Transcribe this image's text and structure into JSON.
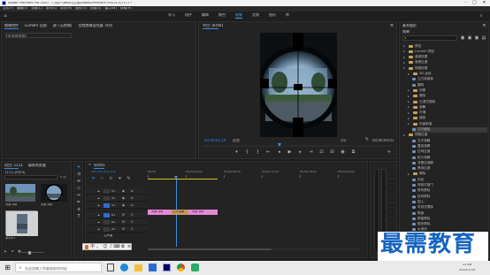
{
  "title_bar": {
    "title": "Adobe Premiere Pro 2020 - C:\\用户\\Baiyu\\文档\\Adobe\\Premiere Pro\\14.0\\1111 *"
  },
  "menu": [
    "文件(F)",
    "编辑(E)",
    "剪辑(C)",
    "序列(S)",
    "标记(M)",
    "图形(G)",
    "视图(V)",
    "窗口(W)",
    "帮助(H)"
  ],
  "workspace_tabs": [
    "学习",
    "组件",
    "编辑",
    "颜色",
    "效果",
    "音频",
    "图形",
    "库"
  ],
  "active_workspace": "效果",
  "source_panel": {
    "tabs": [
      "效果控件",
      "Lumetri 范围",
      "源: (无剪辑)",
      "音频剪辑混合器: 序列"
    ],
    "info": "(未选择剪辑)"
  },
  "program_monitor": {
    "title": "节目: 序列01",
    "timecode": "00;00;01;14",
    "fit_label": "适合",
    "quality": "1/2",
    "duration": "00;00;04;01"
  },
  "project_panel": {
    "tabs": [
      "项目: 1111",
      "媒体浏览器"
    ],
    "path": "1111.prproj",
    "count": "4 项",
    "items": [
      {
        "label": "大屏.jpg",
        "meta": ""
      },
      {
        "label": "大屏.jpg",
        "meta": ""
      },
      {
        "label": "序列01",
        "meta": ""
      }
    ]
  },
  "timeline": {
    "tab": "序列01",
    "timecode": "00;00;01;14",
    "ruler": [
      "00;00",
      "00;00;04;00",
      "00;00;08;00",
      "00;00;12;00",
      "00;00;16;00",
      "00;00;20;00"
    ],
    "tracks": [
      "V3",
      "V2",
      "V1",
      "A1",
      "A2",
      "A3"
    ],
    "master_label": "主声道",
    "clips": [
      "大屏.jpg",
      "交叉溶解",
      "大屏.jpg"
    ]
  },
  "effects_panel": {
    "title": "基本图形",
    "tab": "效果",
    "tree": [
      {
        "label": "预设",
        "kind": "folder",
        "level": 0
      },
      {
        "label": "Lumetri 预设",
        "kind": "folder",
        "level": 0
      },
      {
        "label": "音频效果",
        "kind": "folder",
        "level": 0
      },
      {
        "label": "音频过渡",
        "kind": "folder",
        "level": 0
      },
      {
        "label": "视频效果",
        "kind": "folder",
        "level": 0
      },
      {
        "label": "3D 运动",
        "kind": "folder",
        "level": 1
      },
      {
        "label": "立方体旋转",
        "kind": "fx",
        "level": 2
      },
      {
        "label": "翻转",
        "kind": "fx",
        "level": 2
      },
      {
        "label": "划像",
        "kind": "folder",
        "level": 1
      },
      {
        "label": "擦除",
        "kind": "folder",
        "level": 1
      },
      {
        "label": "沉浸式视频",
        "kind": "folder",
        "level": 1
      },
      {
        "label": "溶解",
        "kind": "folder",
        "level": 1
      },
      {
        "label": "内滑",
        "kind": "folder",
        "level": 1
      },
      {
        "label": "缩放",
        "kind": "folder",
        "level": 1
      },
      {
        "label": "页面剥落",
        "kind": "folder",
        "level": 1
      },
      {
        "label": "交叉缩放",
        "kind": "fx",
        "level": 2,
        "selected": true
      },
      {
        "label": "视频过渡",
        "kind": "folder",
        "level": 0
      },
      {
        "label": "交叉溶解",
        "kind": "fx",
        "level": 2
      },
      {
        "label": "叠加溶解",
        "kind": "fx",
        "level": 2
      },
      {
        "label": "白场过渡",
        "kind": "fx",
        "level": 2
      },
      {
        "label": "胶片溶解",
        "kind": "fx",
        "level": 2
      },
      {
        "label": "非叠加溶解",
        "kind": "fx",
        "level": 2
      },
      {
        "label": "黑场过渡",
        "kind": "fx",
        "level": 2
      },
      {
        "label": "擦除",
        "kind": "folder",
        "level": 1
      },
      {
        "label": "划出",
        "kind": "fx",
        "level": 2
      },
      {
        "label": "双侧平推门",
        "kind": "fx",
        "level": 2
      },
      {
        "label": "带状擦除",
        "kind": "fx",
        "level": 2
      },
      {
        "label": "径向擦除",
        "kind": "fx",
        "level": 2
      },
      {
        "label": "插入",
        "kind": "fx",
        "level": 2
      },
      {
        "label": "时钟式擦除",
        "kind": "fx",
        "level": 2
      },
      {
        "label": "棋盘",
        "kind": "fx",
        "level": 2
      },
      {
        "label": "棋盘擦除",
        "kind": "fx",
        "level": 2
      },
      {
        "label": "楔形擦除",
        "kind": "fx",
        "level": 2
      },
      {
        "label": "水波块",
        "kind": "fx",
        "level": 2
      },
      {
        "label": "油漆飞溅",
        "kind": "fx",
        "level": 2
      },
      {
        "label": "渐变擦除",
        "kind": "fx",
        "level": 2
      },
      {
        "label": "百叶窗",
        "kind": "fx",
        "level": 2
      },
      {
        "label": "螺旋框",
        "kind": "fx",
        "level": 2
      }
    ]
  },
  "taskbar": {
    "search_placeholder": "在这里输入你要搜索的内容",
    "time": "11:18",
    "date": "2021/7/19"
  },
  "watermark": "最需教育",
  "colors": {
    "accent_blue": "#2d8ceb",
    "clip_pink": "#e28ad8",
    "transition": "#c49a62",
    "work_bar": "#d6c21a",
    "playhead": "#3b8fe0",
    "selected_row": "#3a3a3a",
    "watermark": "#1565c0"
  }
}
